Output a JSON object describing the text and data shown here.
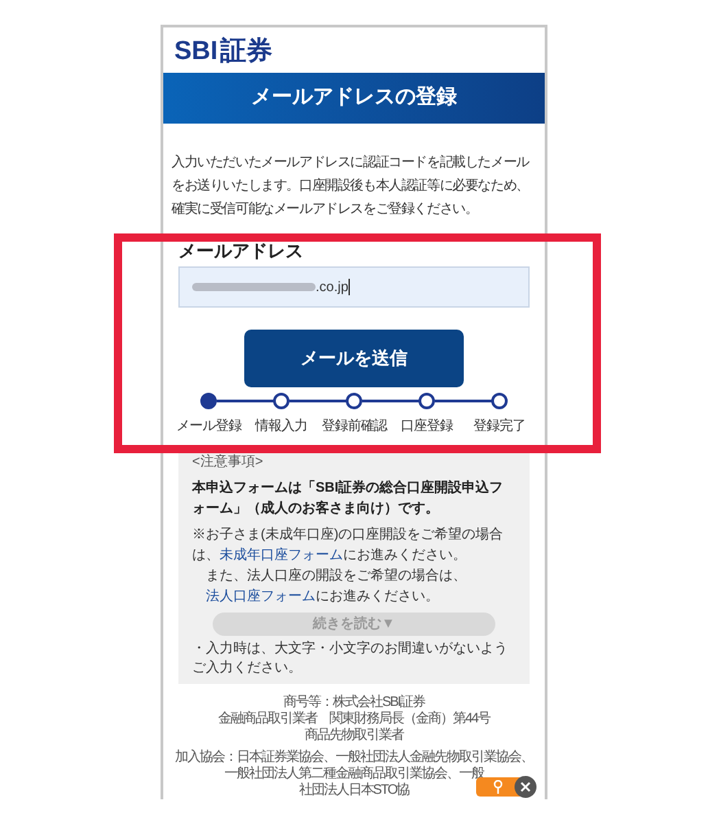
{
  "logo": {
    "brand": "SBI",
    "suffix": "証券"
  },
  "header": {
    "title": "メールアドレスの登録"
  },
  "intro": "入力いただいたメールアドレスに認証コードを記載したメールをお送りいたします。口座開設後も本人認証等に必要なため、確実に受信可能なメールアドレスをご登録ください。",
  "email_field": {
    "label": "メールアドレス",
    "value": ".co.jp",
    "redacted": true
  },
  "submit_button": "メールを送信",
  "steps": [
    {
      "label": "メール登録",
      "selected": true
    },
    {
      "label": "情報入力",
      "selected": false
    },
    {
      "label": "登録前確認",
      "selected": false
    },
    {
      "label": "口座登録",
      "selected": false
    },
    {
      "label": "登録完了",
      "selected": false
    }
  ],
  "notes": {
    "heading": "<注意事項>",
    "lead": "本申込フォームは「SBI証券の総合口座開設申込フォーム」（成人のお客さま向け）です。",
    "paragraphs": [
      [
        {
          "kind": "text",
          "text": "※お子さま(未成年口座)の口座開設をご希望の場合は、"
        },
        {
          "kind": "link",
          "text": "未成年口座フォーム"
        },
        {
          "kind": "text",
          "text": "にお進みください。"
        }
      ],
      [
        {
          "kind": "text",
          "text": "また、法人口座の開設をご希望の場合は、"
        },
        {
          "kind": "link",
          "text": "法人口座フォーム"
        },
        {
          "kind": "text",
          "text": "にお進みください。"
        }
      ]
    ],
    "read_more": "続きを読む▼",
    "bullet": "・入力時は、大文字・小文字のお間違いがないようご入力ください。"
  },
  "footer": [
    "商号等：株式会社SBI証券",
    "金融商品取引業者　関東財務局長（金商）第44号",
    "商品先物取引業者",
    "加入協会：日本証券業協会、一般社団法人金融先物取引業協会、",
    "一般社団法人第二種金融商品取引業協会、一般社団法人日本STO協"
  ],
  "highlight": {
    "shown": true
  }
}
